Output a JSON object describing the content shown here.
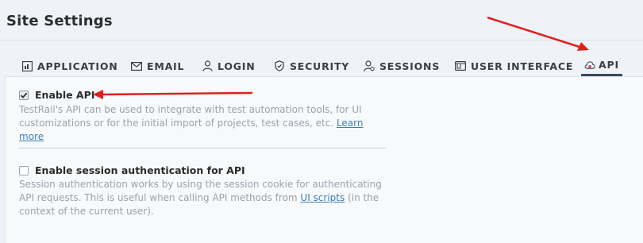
{
  "page": {
    "title": "Site Settings"
  },
  "tabs": [
    {
      "label": "APPLICATION",
      "icon": "application-icon"
    },
    {
      "label": "EMAIL",
      "icon": "email-icon"
    },
    {
      "label": "LOGIN",
      "icon": "login-icon"
    },
    {
      "label": "SECURITY",
      "icon": "shield-icon"
    },
    {
      "label": "SESSIONS",
      "icon": "sessions-icon"
    },
    {
      "label": "USER INTERFACE",
      "icon": "user-interface-icon"
    },
    {
      "label": "API",
      "icon": "api-icon",
      "active": true
    }
  ],
  "api": {
    "enable_api": {
      "label": "Enable API",
      "checked": true,
      "description": "TestRail's API can be used to integrate with test automation tools, for UI customizations or for the initial import of projects, test cases, etc. ",
      "link": "Learn more"
    },
    "session_auth": {
      "label": "Enable session authentication for API",
      "checked": false,
      "description_before": "Session authentication works by using the session cookie for authenticating API requests. This is useful when calling API methods from ",
      "link": "UI scripts",
      "description_after": " (in the context of the current user)."
    }
  },
  "colors": {
    "annotation_arrow": "#e02020",
    "link": "#3c7fb6",
    "active_tab_underline": "#3b4a5c"
  }
}
